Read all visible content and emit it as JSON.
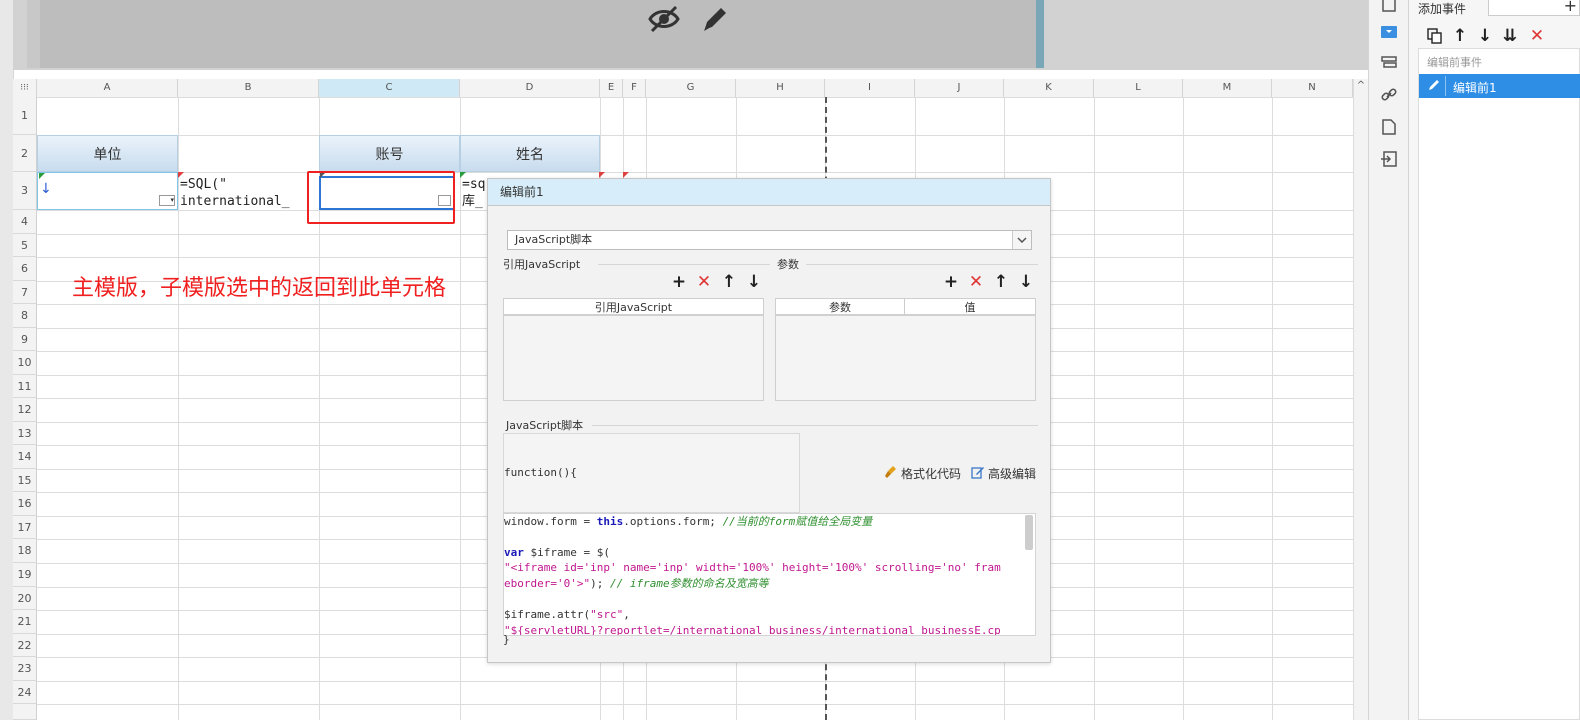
{
  "toolbar_top": {
    "hide_icon": "eye-off-icon",
    "edit_icon": "pencil-icon"
  },
  "sheet": {
    "columns": [
      "A",
      "B",
      "C",
      "D",
      "E",
      "F",
      "G",
      "H",
      "I",
      "J",
      "K",
      "L",
      "M",
      "N"
    ],
    "rows": [
      "1",
      "2",
      "3",
      "4",
      "5",
      "6",
      "7",
      "8",
      "9",
      "10",
      "11",
      "12",
      "13",
      "14",
      "15",
      "16",
      "17",
      "18",
      "19",
      "20",
      "21",
      "22",
      "23",
      "24"
    ],
    "selected_column": "C",
    "header_cells": {
      "a2": "单位",
      "c2": "账号",
      "d2": "姓名"
    },
    "cell_a3": "↓",
    "cell_b3_line1": "=SQL(\"",
    "cell_b3_line2": "international_",
    "cell_d3_line1": "=sq",
    "cell_d3_line2": "库_",
    "annotation": "主模版，子模版选中的返回到此单元格"
  },
  "dialog": {
    "title": "编辑前1",
    "script_type": "JavaScript脚本",
    "ref_js_label": "引用JavaScript",
    "params_label": "参数",
    "ref_js_column": "引用JavaScript",
    "param_column": "参数",
    "value_column": "值",
    "script_section_label": "JavaScript脚本",
    "function_open": "function(){",
    "format_code_label": "格式化代码",
    "advanced_edit_label": "高级编辑",
    "code": {
      "l1_a": "window.form = ",
      "l1_kw": "this",
      "l1_b": ".options.form; ",
      "l1_cmt": "//当前的form赋值给全局变量",
      "l2_kw": "var",
      "l2_b": " $iframe = $(",
      "l3_str": "\"<iframe id='inp' name='inp' width='100%' height='100%' scrolling='no' fram",
      "l4_str": "eborder='0'>\"",
      "l4_b": "); ",
      "l4_cmt": "// iframe参数的命名及宽高等",
      "l5_a": "$iframe.attr(",
      "l5_str": "\"src\"",
      "l5_b": ",",
      "l6_str": "\"${servletURL}?reportlet=/international_business/international_businessE.cp"
    },
    "function_close": "}"
  },
  "events_panel": {
    "title": "添加事件",
    "group_label": "编辑前事件",
    "selected_event": "编辑前1"
  }
}
